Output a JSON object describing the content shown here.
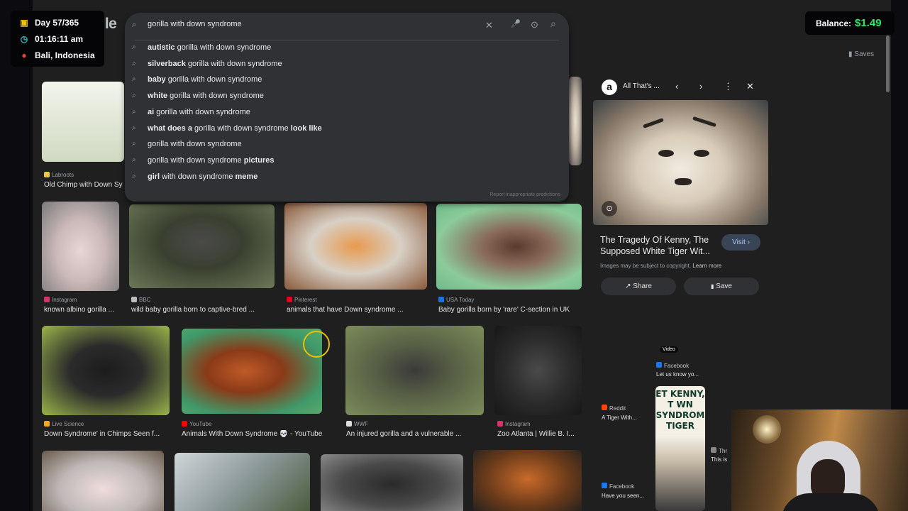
{
  "overlay": {
    "day": "Day 57/365",
    "time": "01:16:11 am",
    "location": "Bali, Indonesia",
    "balance_label": "Balance:",
    "balance_value": "$1.49"
  },
  "logo": "Google",
  "search": {
    "query": "gorilla with down syndrome",
    "suggestions": [
      {
        "bold_prefix": "autistic",
        "rest": " gorilla with down syndrome",
        "bold_suffix": ""
      },
      {
        "bold_prefix": "silverback",
        "rest": " gorilla with down syndrome",
        "bold_suffix": ""
      },
      {
        "bold_prefix": "baby",
        "rest": " gorilla with down syndrome",
        "bold_suffix": ""
      },
      {
        "bold_prefix": "white",
        "rest": " gorilla with down syndrome",
        "bold_suffix": ""
      },
      {
        "bold_prefix": "ai",
        "rest": " gorilla with down syndrome",
        "bold_suffix": ""
      },
      {
        "bold_prefix": "what does a",
        "rest": " gorilla with down syndrome ",
        "bold_suffix": "look like"
      },
      {
        "bold_prefix": "",
        "rest": "gorilla with down syndrome",
        "bold_suffix": ""
      },
      {
        "bold_prefix": "",
        "rest": "gorilla with down syndrome ",
        "bold_suffix": "pictures"
      },
      {
        "bold_prefix": "girl",
        "rest": " with down syndrome ",
        "bold_suffix": "meme"
      }
    ],
    "report_text": "Report inappropriate predictions"
  },
  "saves_label": "Saves",
  "results": [
    {
      "source": "Labroots",
      "caption": "Old Chimp with Down Sy",
      "fav": "#e6c84a"
    },
    {
      "source": "Instagram",
      "caption": "known albino gorilla ...",
      "fav": "#d6336c"
    },
    {
      "source": "BBC",
      "caption": "wild baby gorilla born to captive-bred ...",
      "fav": "#bbbbbb"
    },
    {
      "source": "Pinterest",
      "caption": "animals that have Down syndrome ...",
      "fav": "#e60023"
    },
    {
      "source": "USA Today",
      "caption": "Baby gorilla born by 'rare' C-section in UK",
      "fav": "#1a73e8"
    },
    {
      "source": "Live Science",
      "caption": "Down Syndrome' in Chimps Seen f...",
      "fav": "#f5a623"
    },
    {
      "source": "YouTube",
      "caption": "Animals With Down Syndrome 💀 - YouTube",
      "fav": "#ff0000"
    },
    {
      "source": "WWF",
      "caption": "An injured gorilla and a vulnerable ...",
      "fav": "#dddddd"
    },
    {
      "source": "Instagram",
      "caption": "Zoo Atlanta | Willie B. I...",
      "fav": "#d6336c"
    }
  ],
  "panel": {
    "source_initial": "a",
    "source_title": "All That's ...",
    "title": "The Tragedy Of Kenny, The Supposed White Tiger Wit...",
    "visit_label": "Visit",
    "copyright": "Images may be subject to copyright.",
    "learn_more": "Learn more",
    "share_label": "Share",
    "save_label": "Save",
    "related": [
      {
        "source": "Reddit",
        "caption": "A Tiger With...",
        "fav": "#ff4500"
      },
      {
        "source": "Facebook",
        "caption": "Let us know yo...",
        "fav": "#1877f2",
        "tag": "Video"
      },
      {
        "source": "Thr",
        "caption": "This is",
        "fav": "#888888"
      },
      {
        "source": "Facebook",
        "caption": "Have you seen...",
        "fav": "#1877f2"
      }
    ],
    "kenny_text": "ET KENNY, T WN SYNDROM TIGER"
  },
  "icons": {
    "clear": "✕",
    "mic": "🎤",
    "lens": "⊙",
    "search": "⌕",
    "prev": "‹",
    "next": "›",
    "more": "⋮",
    "close": "✕",
    "share": "↗",
    "bookmark": "▮"
  }
}
